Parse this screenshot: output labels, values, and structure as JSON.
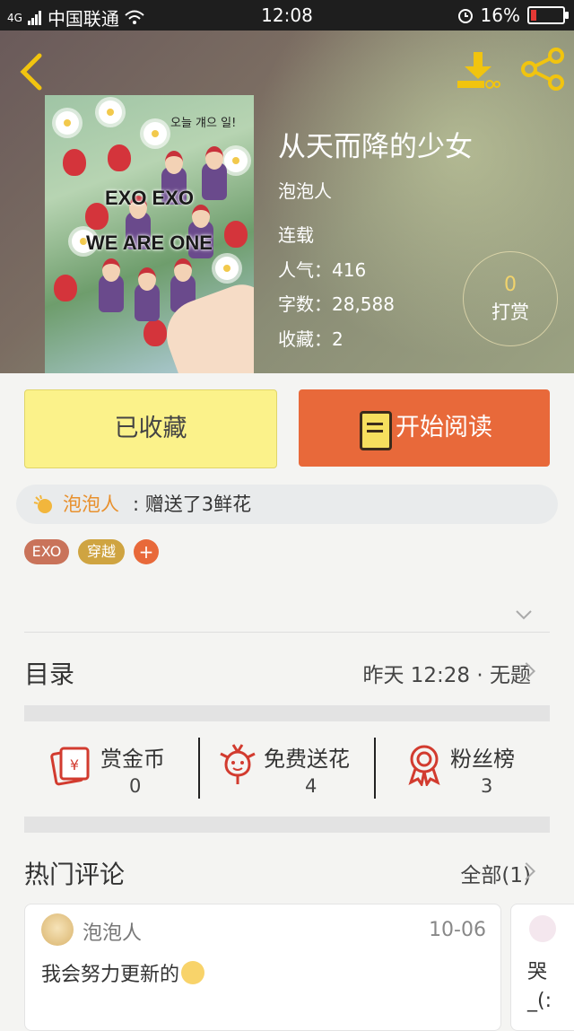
{
  "status_bar": {
    "network": "4G",
    "carrier": "中国联通",
    "time": "12:08",
    "battery_percent": "16%"
  },
  "header": {
    "back_icon": "chevron-left-icon",
    "download_icon": "download-icon",
    "share_icon": "share-icon",
    "accent_color": "#f1c40f"
  },
  "book": {
    "cover_text_line1": "EXO EXO",
    "cover_text_line2": "WE ARE ONE",
    "cover_korean": "오늘 걔으 일!",
    "title": "从天而降的少女",
    "author": "泡泡人",
    "status": "连载",
    "popularity": "人气：416",
    "word_count": "字数：28,588",
    "favorites": "收藏：2"
  },
  "tip": {
    "count": "0",
    "label": "打赏"
  },
  "actions": {
    "favorite_label": "已收藏",
    "read_label": "开始阅读",
    "favorite_color": "#fbf28a",
    "read_color": "#e8693a"
  },
  "gift_notice": {
    "user": "泡泡人",
    "message": ": 赠送了3鲜花"
  },
  "tags": [
    {
      "label": "EXO",
      "color": "#c9735a"
    },
    {
      "label": "穿越",
      "color": "#cfa441"
    },
    {
      "label": "+",
      "color": "#e8693a"
    }
  ],
  "toc": {
    "title": "目录",
    "latest": "昨天 12:28 · 无题"
  },
  "stats": [
    {
      "label": "赏金币",
      "value": "0",
      "icon": "red-envelope-yen-icon"
    },
    {
      "label": "免费送花",
      "value": "4",
      "icon": "flower-icon"
    },
    {
      "label": "粉丝榜",
      "value": "3",
      "icon": "award-ribbon-icon"
    }
  ],
  "hot_comments": {
    "title": "热门评论",
    "all_label": "全部(1)",
    "items": [
      {
        "user": "泡泡人",
        "date": "10-06",
        "text": "我会努力更新的"
      },
      {
        "text_line1": "哭",
        "text_line2": "_(:"
      }
    ]
  }
}
